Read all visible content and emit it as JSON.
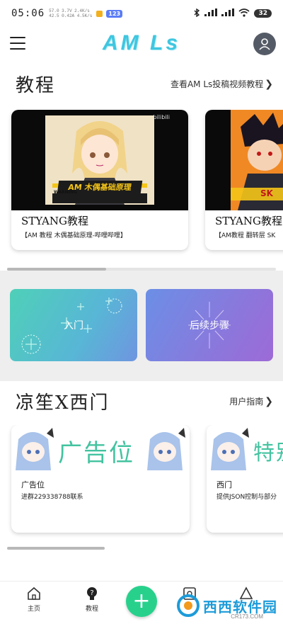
{
  "status_bar": {
    "time": "05:06",
    "net_line1": "57.0 3.7V 2.4K/s",
    "net_line2": "42.5 0.42A 4.5K/s",
    "app_badge": "123",
    "battery": "32"
  },
  "header": {
    "logo": "AM Ls"
  },
  "tutorials": {
    "title": "教程",
    "link_label": "查看AM Ls投稿视频教程",
    "cards": [
      {
        "title": "STYANG教程",
        "subtitle": "【AM 教程 木偶基础原理-哔哩哔哩】",
        "banner": "AM 木偶基础原理",
        "warning": "WARNING",
        "thumb_tag": "bilibili"
      },
      {
        "title": "STYANG教程",
        "subtitle": "【AM教程 翻转层 SK",
        "banner": "SK"
      }
    ]
  },
  "actions": {
    "left_label": "入门",
    "right_label": "后续步骤"
  },
  "community": {
    "title": "凉笙X西门",
    "link_label": "用户指南",
    "cards": [
      {
        "banner": "广告位",
        "title": "广告位",
        "subtitle": "进群229338788联系"
      },
      {
        "banner": "特别",
        "title": "西门",
        "subtitle": "提供JSON控制与部分"
      }
    ]
  },
  "bottom_nav": {
    "home_label": "主页",
    "tutorial_label": "教程",
    "fab_label": "+"
  },
  "watermark": {
    "text": "西西软件园",
    "sub": "CR173.COM"
  },
  "colors": {
    "logo": "#3fc6e0",
    "fab": "#27d18c",
    "action_left": "#58b6d6",
    "action_right": "#8a78dc"
  }
}
